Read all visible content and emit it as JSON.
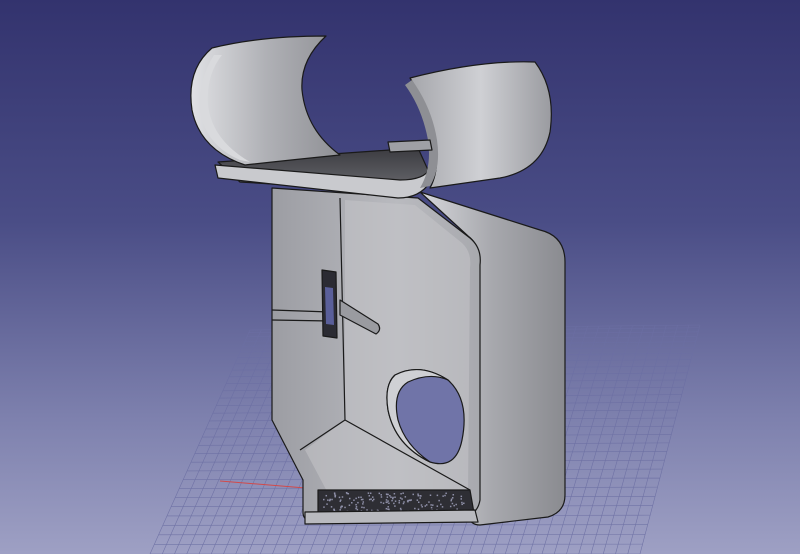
{
  "viewport": {
    "background_top": "#33336e",
    "background_bottom": "#9ea0c4",
    "grid_color": "#6c6fa3",
    "axis_x_color": "#d24a4a",
    "part_face_color": "#b8b9bd",
    "part_edge_color": "#1a1a1a"
  },
  "scene": {
    "object": "sheet-metal-bracket",
    "has_grid_plane": true,
    "has_slot_hole": true,
    "has_rectangular_cutout": true
  }
}
